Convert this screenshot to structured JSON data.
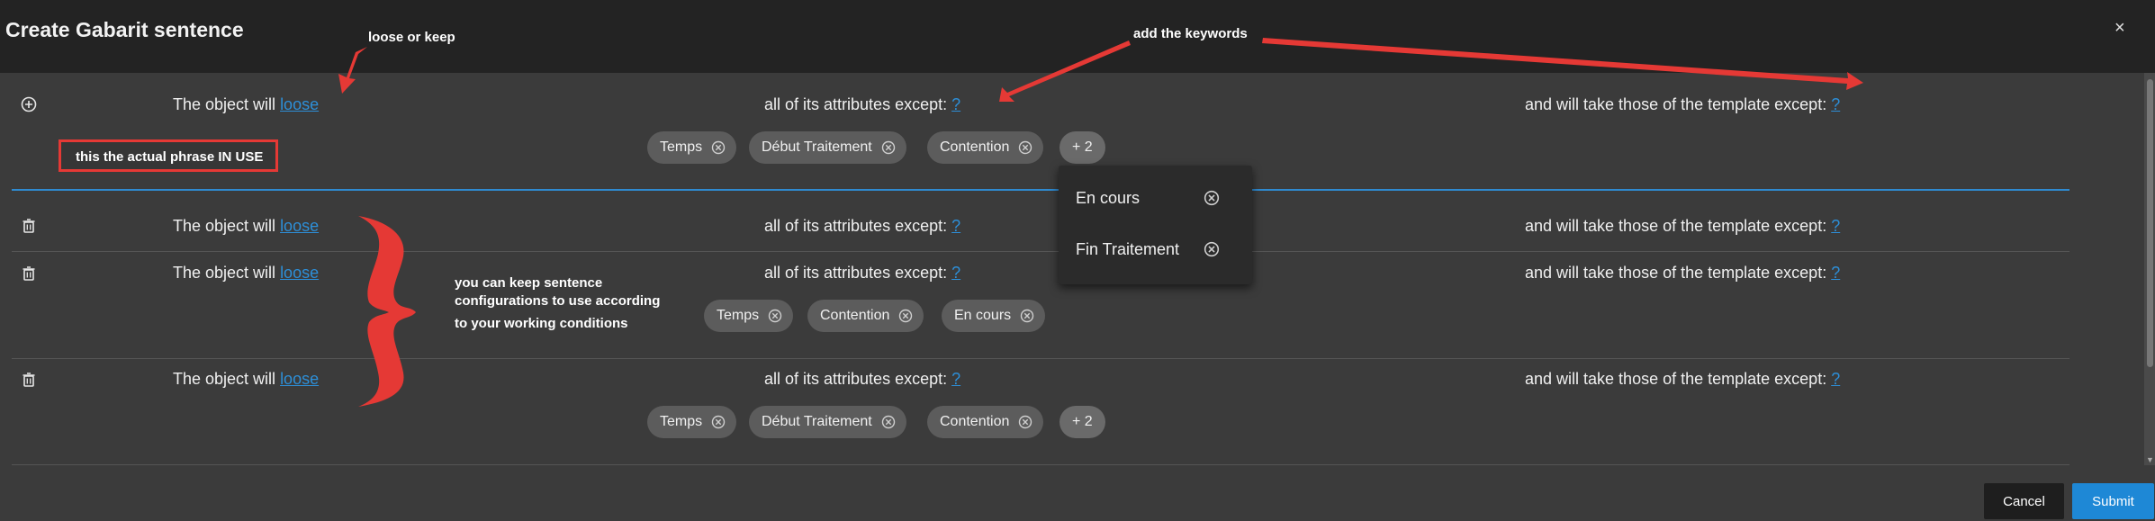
{
  "dialog": {
    "title": "Create Gabarit sentence",
    "close_symbol": "×"
  },
  "sentence": {
    "prefix": "The object will",
    "verb": "loose",
    "middle": "all of its attributes except:",
    "suffix": "and will take those of the template except:",
    "q": "?"
  },
  "current_row": {
    "chips": [
      "Temps",
      "Début Traitement",
      "Contention"
    ],
    "more": "+ 2"
  },
  "saved_rows": [
    {
      "chips": [],
      "more": ""
    },
    {
      "chips": [
        "Temps",
        "Contention",
        "En cours"
      ],
      "more": ""
    },
    {
      "chips": [
        "Temps",
        "Début Traitement",
        "Contention"
      ],
      "more": "+ 2"
    }
  ],
  "popup": {
    "items": [
      "En cours",
      "Fin Traitement"
    ]
  },
  "annotations": {
    "loose_or_keep": "loose or keep",
    "add_keywords": "add the keywords",
    "actual_phrase": "this the actual phrase IN USE",
    "keep_line1": "you can keep sentence",
    "keep_line2": "configurations to use according",
    "keep_line3": "to your working conditions"
  },
  "footer": {
    "cancel": "Cancel",
    "submit": "Submit"
  },
  "colors": {
    "accent": "#1e88d6",
    "link": "#2d8fd8",
    "annotation": "#e53935"
  },
  "icons": {
    "add": "plus-circle-icon",
    "delete": "trash-icon",
    "chip_remove": "close-circle-icon"
  }
}
